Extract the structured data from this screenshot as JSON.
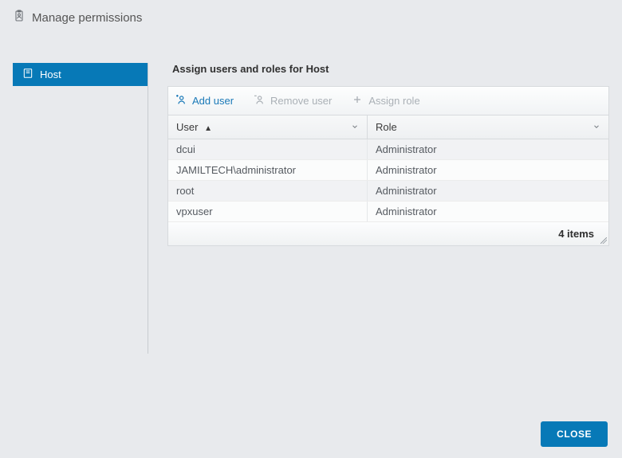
{
  "dialog": {
    "title": "Manage permissions"
  },
  "sidebar": {
    "items": [
      {
        "label": "Host"
      }
    ]
  },
  "main": {
    "title": "Assign users and roles for Host",
    "toolbar": {
      "add_user": "Add user",
      "remove_user": "Remove user",
      "assign_role": "Assign role"
    },
    "columns": {
      "user": "User",
      "role": "Role",
      "sort_indicator": "▲"
    },
    "rows": [
      {
        "user": "dcui",
        "role": "Administrator"
      },
      {
        "user": "JAMILTECH\\administrator",
        "role": "Administrator"
      },
      {
        "user": "root",
        "role": "Administrator"
      },
      {
        "user": "vpxuser",
        "role": "Administrator"
      }
    ],
    "footer": "4 items"
  },
  "footer": {
    "close": "CLOSE"
  }
}
